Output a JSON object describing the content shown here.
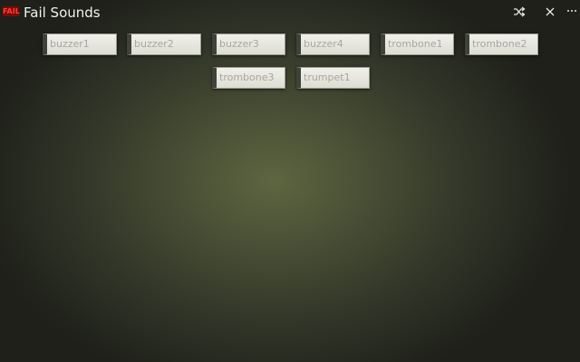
{
  "app": {
    "logo_text": "FAIL",
    "title": "Fail Sounds"
  },
  "titlebar_icons": [
    "shuffle-icon",
    "close-icon",
    "more-options-icon"
  ],
  "sounds": [
    {
      "label": "buzzer1"
    },
    {
      "label": "buzzer2"
    },
    {
      "label": "buzzer3"
    },
    {
      "label": "buzzer4"
    },
    {
      "label": "trombone1"
    },
    {
      "label": "trombone2"
    },
    {
      "label": "trombone3"
    },
    {
      "label": "trumpet1"
    }
  ],
  "colors": {
    "background_center": "#5e6541",
    "background_edge": "#1e2019",
    "button_face": "#f0f0ea",
    "button_text": "#a7a7a0",
    "logo_red": "#ff3b30"
  }
}
